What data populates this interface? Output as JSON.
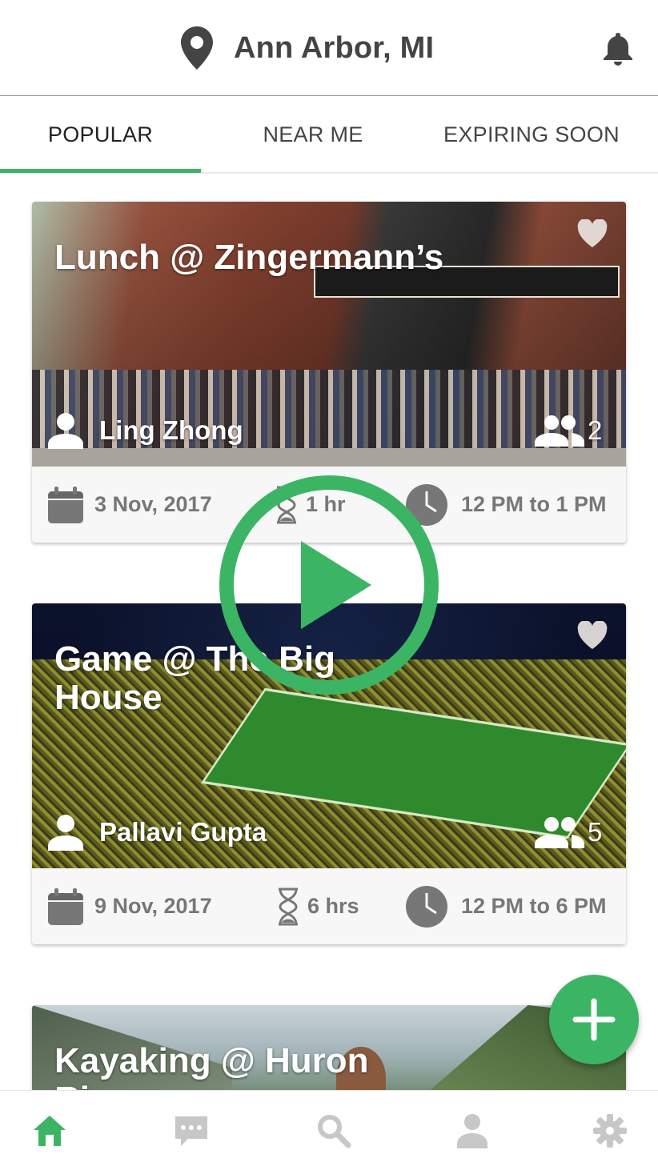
{
  "header": {
    "location": "Ann Arbor, MI",
    "location_icon": "map-pin-icon",
    "notification_icon": "bell-icon"
  },
  "tabs": [
    {
      "label": "POPULAR",
      "active": true
    },
    {
      "label": "NEAR ME",
      "active": false
    },
    {
      "label": "EXPIRING SOON",
      "active": false
    }
  ],
  "events": [
    {
      "title": "Lunch @ Zingermann’s",
      "host": "Ling Zhong",
      "attendees": "2",
      "date": "3 Nov, 2017",
      "duration": "1 hr",
      "time": "12 PM to 1 PM"
    },
    {
      "title": "Game @ The Big House",
      "host": "Pallavi Gupta",
      "attendees": "5",
      "date": "9 Nov, 2017",
      "duration": "6 hrs",
      "time": "12 PM to 6 PM"
    },
    {
      "title": "Kayaking @ Huron River"
    }
  ],
  "overlay": {
    "icon": "play-icon"
  },
  "fab": {
    "icon": "plus-icon"
  },
  "bottom_nav": [
    {
      "name": "home",
      "icon": "home-icon",
      "active": true
    },
    {
      "name": "messages",
      "icon": "chat-icon",
      "active": false
    },
    {
      "name": "search",
      "icon": "search-icon",
      "active": false
    },
    {
      "name": "profile",
      "icon": "person-icon",
      "active": false
    },
    {
      "name": "settings",
      "icon": "gear-icon",
      "active": false
    }
  ],
  "colors": {
    "accent": "#3bb564",
    "text": "#444444",
    "muted_icon": "#c2c2c2",
    "meta_text": "#777777"
  }
}
